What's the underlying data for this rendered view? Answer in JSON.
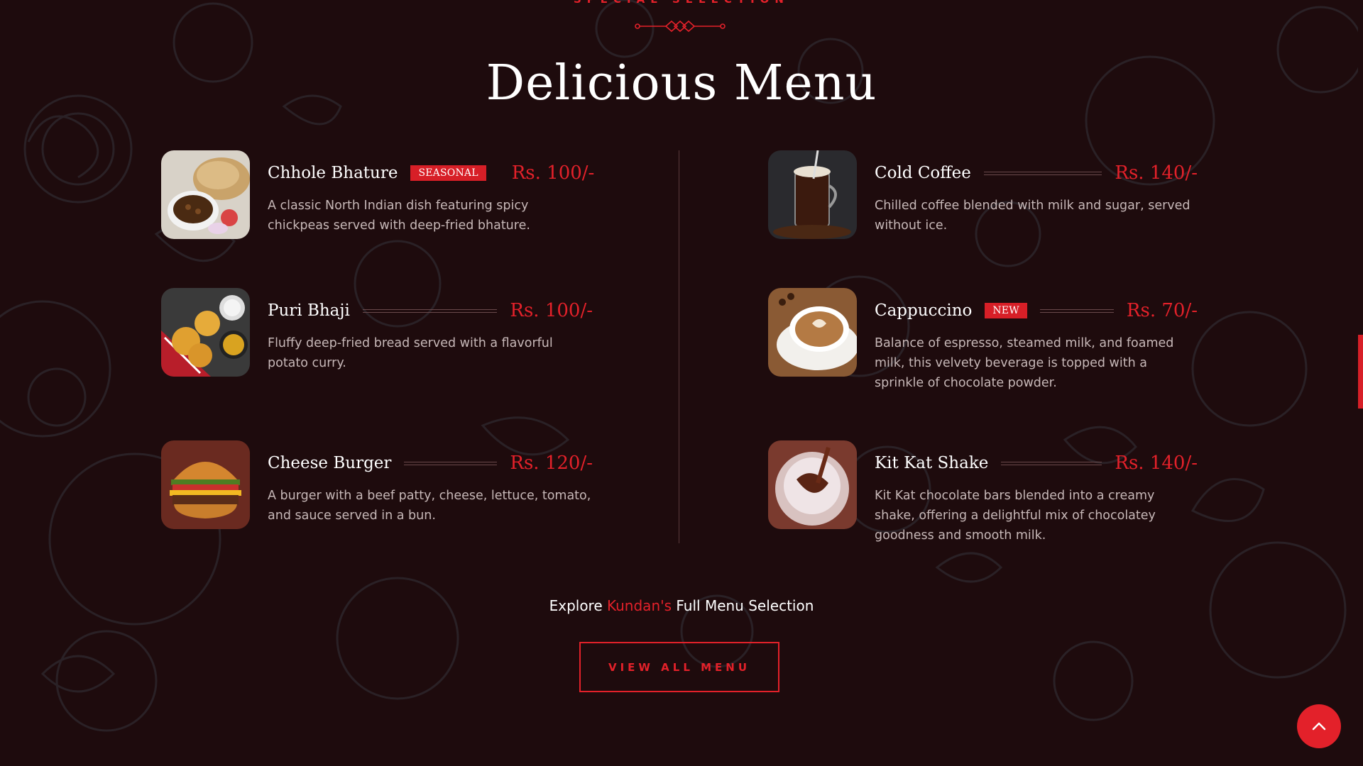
{
  "header": {
    "subtitle": "SPECIAL SELECTION",
    "title": "Delicious Menu"
  },
  "menu_left": [
    {
      "name": "Chhole Bhature",
      "badge": "SEASONAL",
      "price": "Rs. 100/-",
      "description": "A classic North Indian dish featuring spicy chickpeas served with deep-fried bhature.",
      "image": "chhole-bhature-photo"
    },
    {
      "name": "Puri Bhaji",
      "badge": "",
      "price": "Rs. 100/-",
      "description": "Fluffy deep-fried bread served with a flavorful potato curry.",
      "image": "puri-bhaji-photo"
    },
    {
      "name": "Cheese Burger",
      "badge": "",
      "price": "Rs. 120/-",
      "description": "A burger with a beef patty, cheese, lettuce, tomato, and sauce served in a bun.",
      "image": "cheese-burger-photo"
    }
  ],
  "menu_right": [
    {
      "name": "Cold Coffee",
      "badge": "",
      "price": "Rs. 140/-",
      "description": "Chilled coffee blended with milk and sugar, served without ice.",
      "image": "cold-coffee-photo"
    },
    {
      "name": "Cappuccino",
      "badge": "NEW",
      "price": "Rs. 70/-",
      "description": "Balance of espresso, steamed milk, and foamed milk, this velvety beverage is topped with a sprinkle of chocolate powder.",
      "image": "cappuccino-photo"
    },
    {
      "name": "Kit Kat Shake",
      "badge": "",
      "price": "Rs. 140/-",
      "description": "Kit Kat chocolate bars blended into a creamy shake, offering a delightful mix of chocolatey goodness and smooth milk.",
      "image": "kitkat-shake-photo"
    }
  ],
  "explore": {
    "prefix": "Explore",
    "brand": "Kundan's",
    "suffix": "Full Menu Selection"
  },
  "cta": {
    "label": "VIEW ALL MENU"
  },
  "icons": {
    "scroll_top": "chevron-up-icon",
    "ornament": "divider-ornament-icon"
  },
  "colors": {
    "accent": "#e3212a",
    "background": "#1e0b0d",
    "text": "#ffffff",
    "muted": "#c7b8b8"
  }
}
